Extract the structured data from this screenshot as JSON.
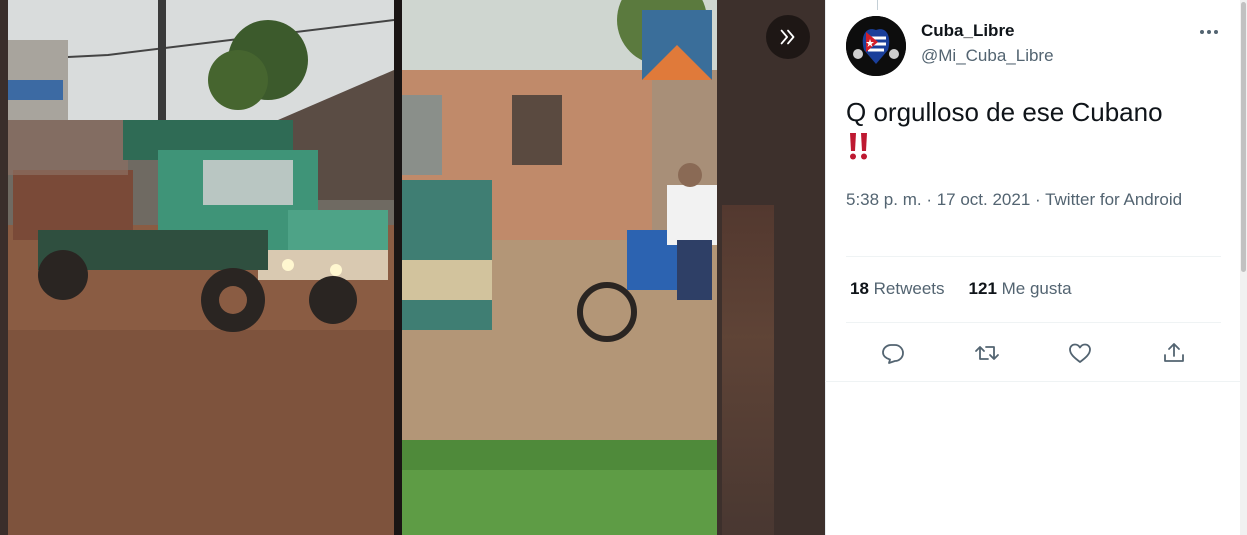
{
  "tweet": {
    "display_name": "Cuba_Libre",
    "handle": "@Mi_Cuba_Libre",
    "text": "Q orgulloso de ese Cubano",
    "emoji": "‼️",
    "timestamp": "5:38 p. m. · 17 oct. 2021 · ",
    "source": "Twitter for Android",
    "retweets_count": "18",
    "retweets_label": "Retweets",
    "likes_count": "121",
    "likes_label": "Me gusta"
  },
  "icons": {
    "collapse": "double-chevron-right-icon",
    "more": "more-horizontal-icon",
    "reply": "reply-icon",
    "retweet": "retweet-icon",
    "like": "heart-icon",
    "share": "share-icon"
  },
  "colors": {
    "text_primary": "#0f1419",
    "text_secondary": "#536471",
    "media_background": "#3a2e2b"
  }
}
